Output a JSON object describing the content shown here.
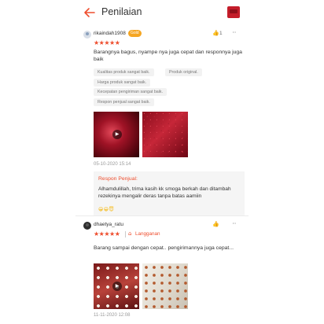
{
  "header": {
    "title": "Penilaian",
    "back_icon": "arrow-left-icon",
    "cart_icon": "cart-icon",
    "accent": "#ee4d2d"
  },
  "reviews": [
    {
      "username": "rikaindah1908",
      "badge": "Gold",
      "likes": "1",
      "rating_stars": "★★★★★",
      "rating": 5,
      "text": "Barangnya bagus, nyampe nya juga cepat dan responnya juga baik",
      "tags": [
        "Kualitas produk sangat baik.",
        "Produk original.",
        "Harga produk sangat baik.",
        "Kecepatan pengiriman sangat baik.",
        "Respon penjual sangat baik."
      ],
      "date": "05-10-2020 15:14",
      "seller_response": {
        "title": "Respon Penjual:",
        "text": "Alhamdulillah, trima kasih kk smoga berkah dan ditambah rezekinya mengalir deras tanpa batas aamiin",
        "emojis": "😁😁😇"
      }
    },
    {
      "username": "dhaetya_ratu",
      "rating_stars": "★★★★★",
      "rating": 5,
      "subscription_label": "Langganan",
      "text": "Barang sampai dengan cepat.. pengirimannya juga cepat...",
      "date": "11-11-2020 12:08"
    }
  ],
  "colors": {
    "star": "#ee4d2d",
    "badge": "#f5a623",
    "response_bg": "#f5f5f5"
  }
}
